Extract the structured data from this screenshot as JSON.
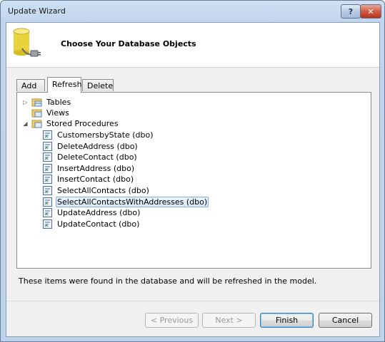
{
  "window": {
    "title": "Update Wizard"
  },
  "header": {
    "title": "Choose Your Database Objects"
  },
  "tabs": [
    {
      "label": "Add"
    },
    {
      "label": "Refresh"
    },
    {
      "label": "Delete"
    }
  ],
  "tree": {
    "tables_label": "Tables",
    "views_label": "Views",
    "sprocs_label": "Stored Procedures",
    "procedures": [
      "CustomersbyState (dbo)",
      "DeleteAddress (dbo)",
      "DeleteContact (dbo)",
      "InsertAddress (dbo)",
      "InsertContact (dbo)",
      "SelectAllContacts (dbo)",
      "SelectAllContactsWithAddresses (dbo)",
      "UpdateAddress (dbo)",
      "UpdateContact (dbo)"
    ],
    "selected_procedure": "SelectAllContactsWithAddresses (dbo)"
  },
  "status_text": "These items were found in the database and will be refreshed in the model.",
  "buttons": {
    "previous": "< Previous",
    "next": "Next >",
    "finish": "Finish",
    "cancel": "Cancel"
  }
}
